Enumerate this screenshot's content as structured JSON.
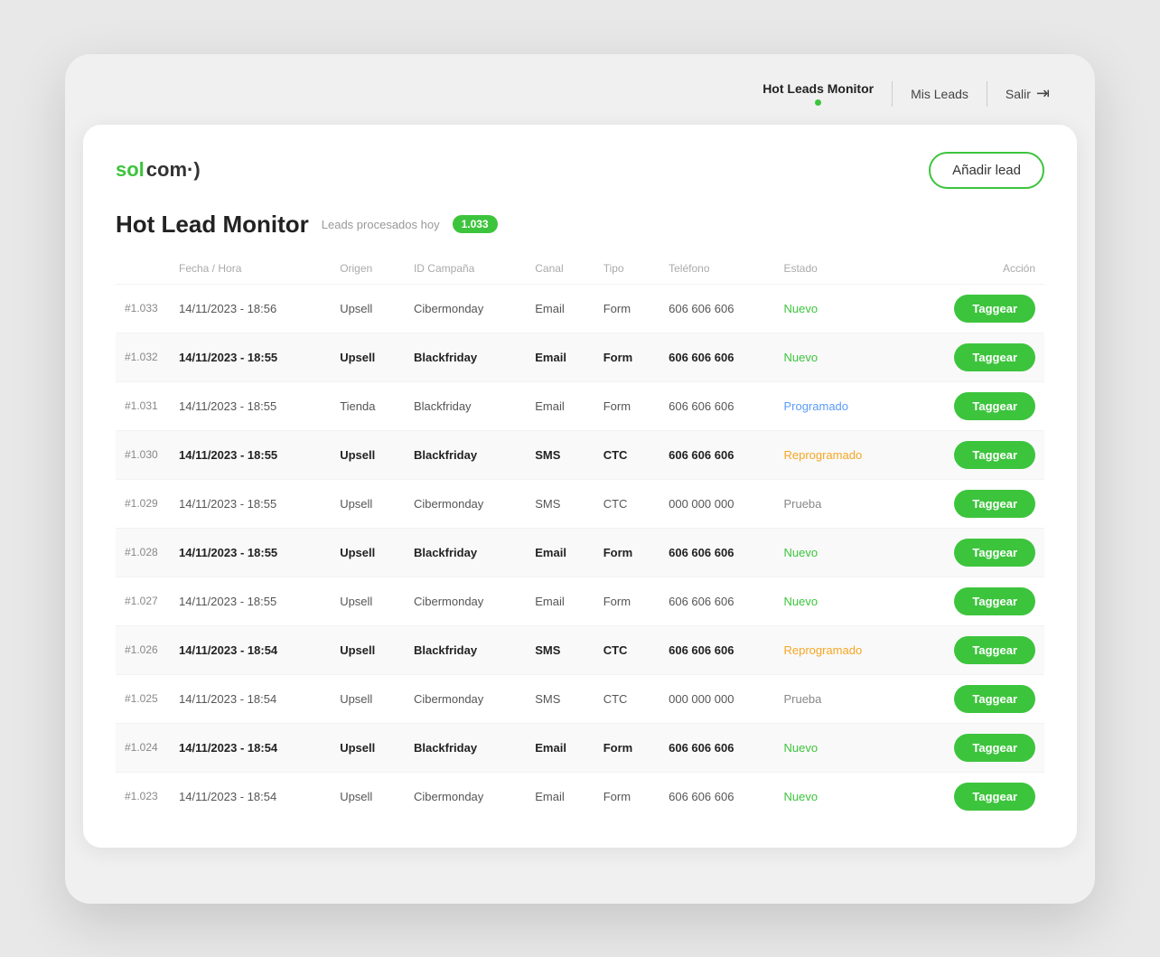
{
  "nav": {
    "active_label": "Hot Leads Monitor",
    "mis_leads_label": "Mis Leads",
    "salir_label": "Salir",
    "logout_icon": "⇥"
  },
  "logo": {
    "sol": "sol",
    "com": "com·)",
    "wave": "·)"
  },
  "add_lead_button": "Añadir lead",
  "section": {
    "title": "Hot Lead Monitor",
    "leads_processed_label": "Leads procesados hoy",
    "badge_count": "1.033"
  },
  "table": {
    "headers": {
      "id": "",
      "fecha_hora": "Fecha / Hora",
      "origen": "Origen",
      "id_campana": "ID Campaña",
      "canal": "Canal",
      "tipo": "Tipo",
      "telefono": "Teléfono",
      "estado": "Estado",
      "accion": "Acción"
    },
    "rows": [
      {
        "id": "#1.033",
        "fecha": "14/11/2023 - 18:56",
        "origen": "Upsell",
        "campana": "Cibermonday",
        "canal": "Email",
        "tipo": "Form",
        "telefono": "606 606 606",
        "estado": "Nuevo",
        "estado_class": "status-nuevo",
        "highlighted": false,
        "bold": false
      },
      {
        "id": "#1.032",
        "fecha": "14/11/2023 - 18:55",
        "origen": "Upsell",
        "campana": "Blackfriday",
        "canal": "Email",
        "tipo": "Form",
        "telefono": "606 606 606",
        "estado": "Nuevo",
        "estado_class": "status-nuevo",
        "highlighted": true,
        "bold": true
      },
      {
        "id": "#1.031",
        "fecha": "14/11/2023 - 18:55",
        "origen": "Tienda",
        "campana": "Blackfriday",
        "canal": "Email",
        "tipo": "Form",
        "telefono": "606 606 606",
        "estado": "Programado",
        "estado_class": "status-programado",
        "highlighted": false,
        "bold": false
      },
      {
        "id": "#1.030",
        "fecha": "14/11/2023 - 18:55",
        "origen": "Upsell",
        "campana": "Blackfriday",
        "canal": "SMS",
        "tipo": "CTC",
        "telefono": "606 606 606",
        "estado": "Reprogramado",
        "estado_class": "status-reprogramado",
        "highlighted": true,
        "bold": true
      },
      {
        "id": "#1.029",
        "fecha": "14/11/2023 - 18:55",
        "origen": "Upsell",
        "campana": "Cibermonday",
        "canal": "SMS",
        "tipo": "CTC",
        "telefono": "000 000 000",
        "estado": "Prueba",
        "estado_class": "status-prueba",
        "highlighted": false,
        "bold": false
      },
      {
        "id": "#1.028",
        "fecha": "14/11/2023 - 18:55",
        "origen": "Upsell",
        "campana": "Blackfriday",
        "canal": "Email",
        "tipo": "Form",
        "telefono": "606 606 606",
        "estado": "Nuevo",
        "estado_class": "status-nuevo",
        "highlighted": true,
        "bold": true
      },
      {
        "id": "#1.027",
        "fecha": "14/11/2023 - 18:55",
        "origen": "Upsell",
        "campana": "Cibermonday",
        "canal": "Email",
        "tipo": "Form",
        "telefono": "606 606 606",
        "estado": "Nuevo",
        "estado_class": "status-nuevo",
        "highlighted": false,
        "bold": false
      },
      {
        "id": "#1.026",
        "fecha": "14/11/2023 - 18:54",
        "origen": "Upsell",
        "campana": "Blackfriday",
        "canal": "SMS",
        "tipo": "CTC",
        "telefono": "606 606 606",
        "estado": "Reprogramado",
        "estado_class": "status-reprogramado",
        "highlighted": true,
        "bold": true
      },
      {
        "id": "#1.025",
        "fecha": "14/11/2023 - 18:54",
        "origen": "Upsell",
        "campana": "Cibermonday",
        "canal": "SMS",
        "tipo": "CTC",
        "telefono": "000 000 000",
        "estado": "Prueba",
        "estado_class": "status-prueba",
        "highlighted": false,
        "bold": false
      },
      {
        "id": "#1.024",
        "fecha": "14/11/2023 - 18:54",
        "origen": "Upsell",
        "campana": "Blackfriday",
        "canal": "Email",
        "tipo": "Form",
        "telefono": "606 606 606",
        "estado": "Nuevo",
        "estado_class": "status-nuevo",
        "highlighted": true,
        "bold": true
      },
      {
        "id": "#1.023",
        "fecha": "14/11/2023 - 18:54",
        "origen": "Upsell",
        "campana": "Cibermonday",
        "canal": "Email",
        "tipo": "Form",
        "telefono": "606 606 606",
        "estado": "Nuevo",
        "estado_class": "status-nuevo",
        "highlighted": false,
        "bold": false
      }
    ],
    "taggear_label": "Taggear"
  }
}
